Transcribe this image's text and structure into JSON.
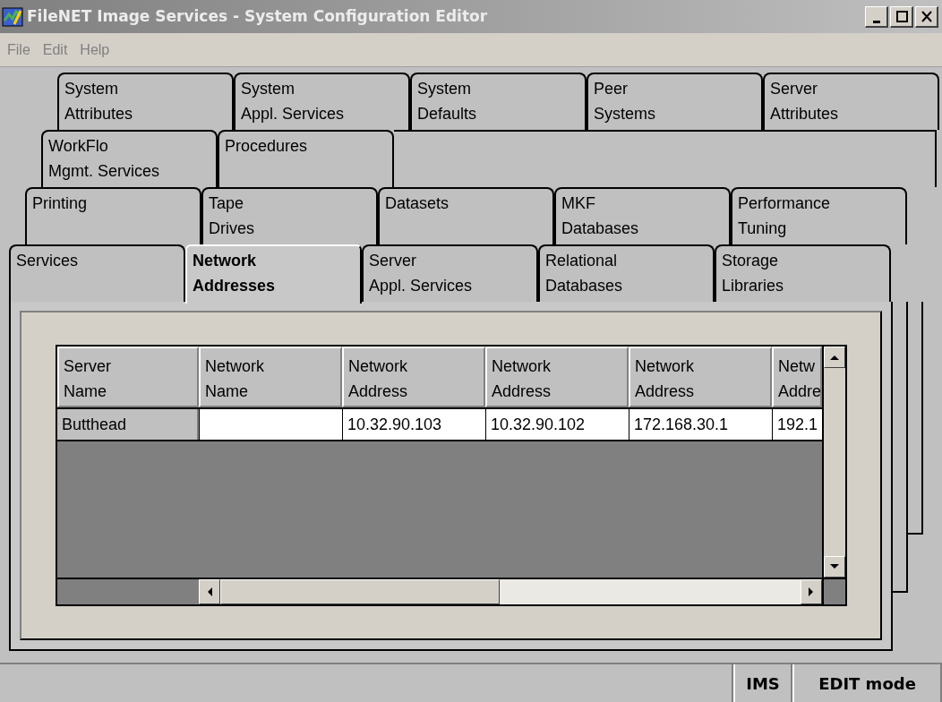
{
  "window": {
    "title": "FileNET Image Services - System Configuration Editor"
  },
  "menu": [
    "File",
    "Edit",
    "Help"
  ],
  "tab_rows": [
    [
      {
        "label": "System\nAttributes",
        "selected": false
      },
      {
        "label": "System\nAppl. Services",
        "selected": false
      },
      {
        "label": "System\nDefaults",
        "selected": false
      },
      {
        "label": "Peer\nSystems",
        "selected": false
      },
      {
        "label": "Server\nAttributes",
        "selected": false
      }
    ],
    [
      {
        "label": "WorkFlo\nMgmt. Services",
        "selected": false
      },
      {
        "label": "Procedures",
        "selected": false
      }
    ],
    [
      {
        "label": "Printing",
        "selected": false
      },
      {
        "label": "Tape\nDrives",
        "selected": false
      },
      {
        "label": "Datasets",
        "selected": false
      },
      {
        "label": "MKF\nDatabases",
        "selected": false
      },
      {
        "label": "Performance\nTuning",
        "selected": false
      }
    ],
    [
      {
        "label": "Services",
        "selected": false
      },
      {
        "label": "Network\nAddresses",
        "selected": true
      },
      {
        "label": "Server\nAppl. Services",
        "selected": false
      },
      {
        "label": "Relational\nDatabases",
        "selected": false
      },
      {
        "label": "Storage\nLibraries",
        "selected": false
      }
    ]
  ],
  "table": {
    "columns": [
      "Server\nName",
      "Network\nName",
      "Network\nAddress",
      "Network\nAddress",
      "Network\nAddress",
      "Netw\nAddre"
    ],
    "rows": [
      [
        "Butthead",
        null,
        "10.32.90.103",
        "10.32.90.102",
        "172.168.30.1",
        "192.1"
      ]
    ]
  },
  "status_bar": {
    "sections": [
      "IMS",
      "EDIT mode"
    ]
  }
}
